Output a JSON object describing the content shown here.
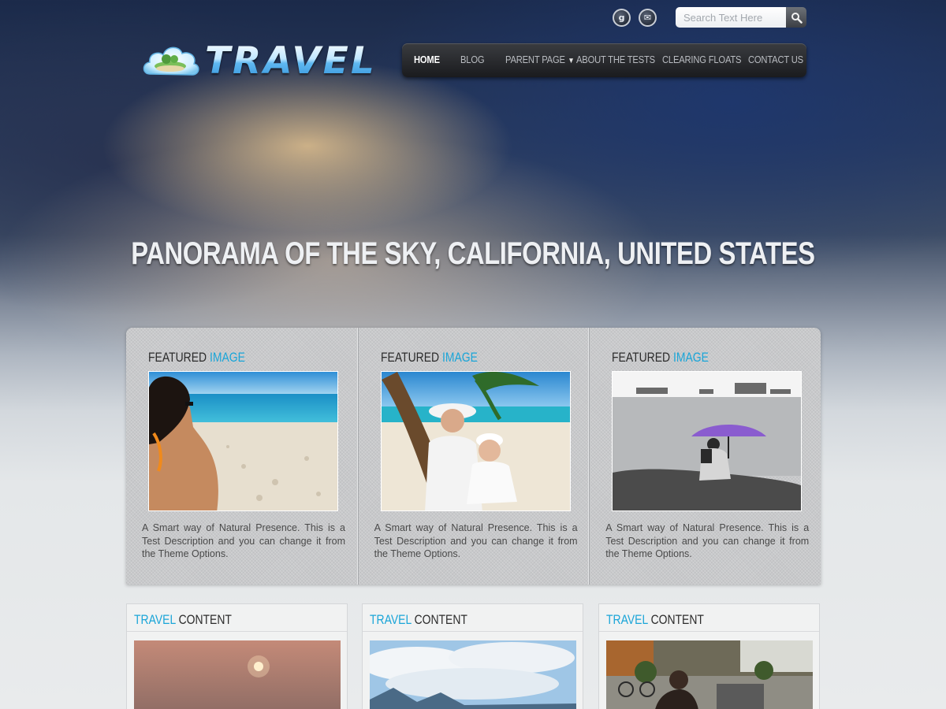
{
  "header": {
    "logo_text": "TRAVEL",
    "social": [
      {
        "icon": "google-plus-icon",
        "glyph": "g"
      },
      {
        "icon": "mail-icon",
        "glyph": "✉"
      }
    ],
    "search": {
      "placeholder": "Search Text Here",
      "value": ""
    }
  },
  "nav": {
    "items": [
      {
        "label": "HOME",
        "active": true
      },
      {
        "label": "BLOG"
      },
      {
        "label": "PARENT PAGE",
        "has_dropdown": true
      },
      {
        "label": "ABOUT THE TESTS"
      },
      {
        "label": "CLEARING FLOATS"
      },
      {
        "label": "CONTACT US"
      }
    ]
  },
  "hero": {
    "headline": "PANORAMA OF THE SKY, CALIFORNIA, UNITED STATES"
  },
  "featured": {
    "items": [
      {
        "title_a": "FEATURED",
        "title_b": "IMAGE",
        "description": "A Smart way of Natural Presence. This is a Test Description and you can change it from the Theme Options."
      },
      {
        "title_a": "FEATURED",
        "title_b": "IMAGE",
        "description": "A Smart way of Natural Presence. This is a Test Description and you can change it from the Theme Options."
      },
      {
        "title_a": "FEATURED",
        "title_b": "IMAGE",
        "description": "A Smart way of Natural Presence. This is a Test Description and you can change it from the Theme Options."
      }
    ]
  },
  "content": {
    "items": [
      {
        "title_a": "TRAVEL",
        "title_b": "CONTENT"
      },
      {
        "title_a": "TRAVEL",
        "title_b": "CONTENT"
      },
      {
        "title_a": "TRAVEL",
        "title_b": "CONTENT"
      }
    ]
  },
  "colors": {
    "accent": "#1aa5d8",
    "nav_bg": "#1a1b1e"
  }
}
